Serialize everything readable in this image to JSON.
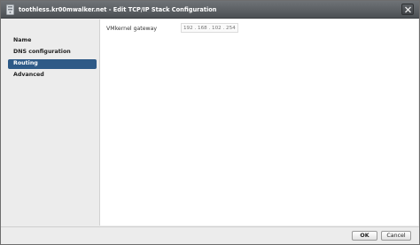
{
  "window": {
    "title": "toothless.kr00mwalker.net - Edit TCP/IP Stack Configuration",
    "title_icon": "host-icon",
    "close_icon": "close-icon"
  },
  "sidebar": {
    "items": [
      {
        "label": "Name",
        "active": false
      },
      {
        "label": "DNS configuration",
        "active": false
      },
      {
        "label": "Routing",
        "active": true
      },
      {
        "label": "Advanced",
        "active": false
      }
    ]
  },
  "routing": {
    "gateway_label": "VMkernel gateway",
    "gateway_value": "",
    "gateway_placeholder": "192 . 168 . 102 . 254"
  },
  "footer": {
    "ok_label": "OK",
    "cancel_label": "Cancel"
  },
  "colors": {
    "titlebar": "#5a5e62",
    "active_nav": "#2e5a87",
    "dialog_bg": "#ececec"
  }
}
